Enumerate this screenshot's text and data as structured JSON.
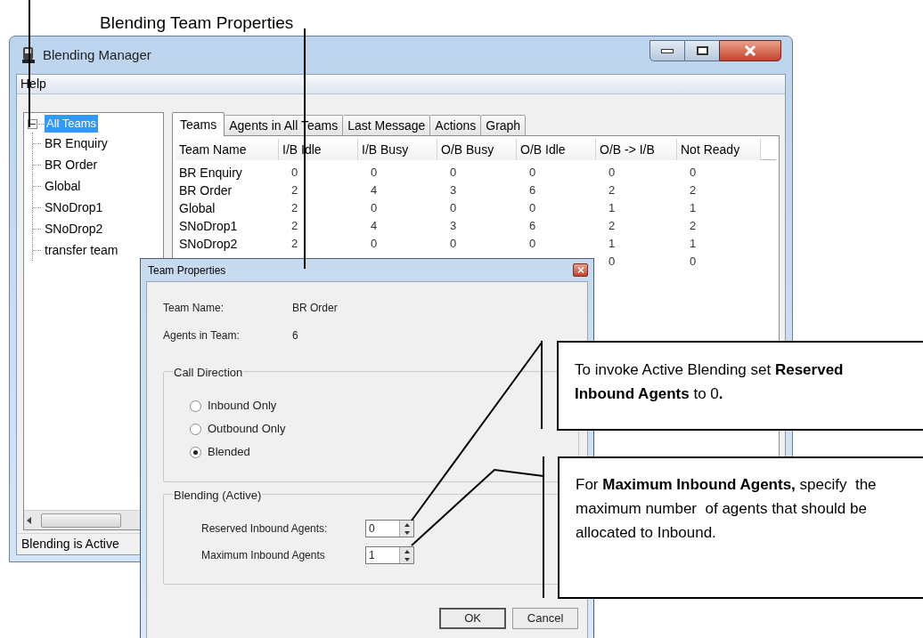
{
  "caption": "Blending Team Properties",
  "window": {
    "title": "Blending Manager"
  },
  "menu": [
    "Help"
  ],
  "tree": [
    {
      "label": "All Teams",
      "selected": true,
      "expanded": true,
      "children": [
        {
          "label": "BR Enquiry",
          "selected": false
        },
        {
          "label": "BR Order",
          "selected": false
        },
        {
          "label": "Global",
          "selected": false
        },
        {
          "label": "SNoDrop1",
          "selected": false
        },
        {
          "label": "SNoDrop2",
          "selected": false
        },
        {
          "label": "transfer team",
          "selected": false
        }
      ]
    }
  ],
  "tabs": [
    {
      "label": "Teams",
      "selected": true
    },
    {
      "label": "Agents in All Teams",
      "selected": false
    },
    {
      "label": "Last Message",
      "selected": false
    },
    {
      "label": "Actions",
      "selected": false
    },
    {
      "label": "Graph",
      "selected": false
    }
  ],
  "table": {
    "columns": [
      "Team Name",
      "I/B Idle",
      "I/B Busy",
      "O/B Busy",
      "O/B Idle",
      "O/B -> I/B",
      "Not Ready"
    ],
    "rows": [
      [
        "BR Enquiry",
        "0",
        "0",
        "0",
        "0",
        "0",
        "0"
      ],
      [
        "BR Order",
        "2",
        "4",
        "3",
        "6",
        "2",
        "2"
      ],
      [
        "Global",
        "2",
        "0",
        "0",
        "0",
        "1",
        "1"
      ],
      [
        "SNoDrop1",
        "2",
        "4",
        "3",
        "6",
        "2",
        "2"
      ],
      [
        "SNoDrop2",
        "2",
        "0",
        "0",
        "0",
        "1",
        "1"
      ],
      [
        null,
        null,
        null,
        null,
        null,
        "0",
        "0"
      ]
    ]
  },
  "status_bar": "Blending is Active",
  "dialog": {
    "title": "Team Properties",
    "info": [
      {
        "label": "Team Name:",
        "value": "BR Order"
      },
      {
        "label": "Agents in Team:",
        "value": "6"
      }
    ],
    "call_direction": {
      "title": "Call Direction",
      "options": [
        {
          "label": "Inbound Only",
          "selected": false
        },
        {
          "label": "Outbound Only",
          "selected": false
        },
        {
          "label": "Blended",
          "selected": true
        }
      ]
    },
    "blending": {
      "title": "Blending (Active)",
      "fields": [
        {
          "label": "Reserved Inbound Agents:",
          "value": "0"
        },
        {
          "label": "Maximum Inbound Agents",
          "value": "1"
        }
      ]
    },
    "buttons": [
      "OK",
      "Cancel"
    ]
  },
  "callouts": [
    "To invoke Active Blending set **Reserved Inbound Agents** to 0**.**",
    "For **Maximum Inbound Agents,** specify  the maximum number  of agents that should be allocated to Inbound."
  ]
}
